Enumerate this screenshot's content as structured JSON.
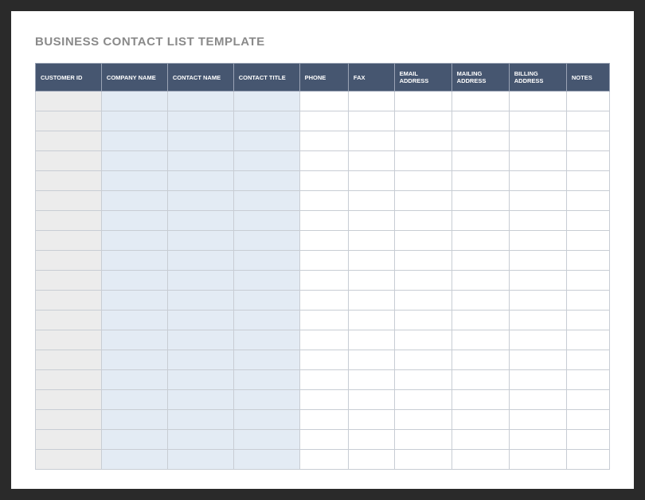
{
  "title": "BUSINESS CONTACT LIST TEMPLATE",
  "columns": [
    "CUSTOMER ID",
    "COMPANY NAME",
    "CONTACT NAME",
    "CONTACT TITLE",
    "PHONE",
    "FAX",
    "EMAIL ADDRESS",
    "MAILING ADDRESS",
    "BILLING ADDRESS",
    "NOTES"
  ],
  "row_count": 19,
  "colors": {
    "header_bg": "#465670",
    "header_fg": "#ffffff",
    "id_col_bg": "#ececec",
    "blue_col_bg": "#e3ebf4",
    "white_col_bg": "#ffffff",
    "title_fg": "#8a8a8a",
    "page_border": "#2a2a2a"
  }
}
